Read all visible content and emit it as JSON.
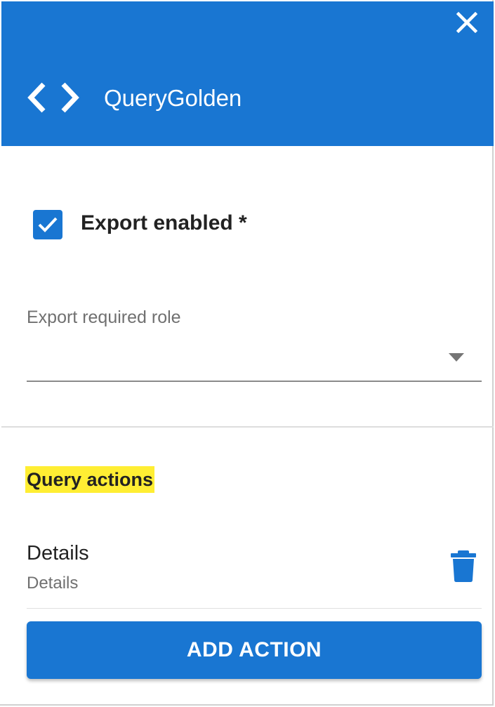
{
  "header": {
    "title": "QueryGolden",
    "icon": "code-icon",
    "close_icon": "close-icon",
    "background": "#1976d2"
  },
  "export": {
    "enabled_label": "Export enabled *",
    "enabled": true,
    "required_role_label": "Export required role",
    "required_role_value": ""
  },
  "query_actions": {
    "title": "Query actions",
    "highlight_color": "#ffee33",
    "items": [
      {
        "title": "Details",
        "subtitle": "Details",
        "delete_icon": "trash-icon"
      }
    ],
    "add_label": "ADD ACTION"
  },
  "colors": {
    "accent": "#1976d2"
  }
}
